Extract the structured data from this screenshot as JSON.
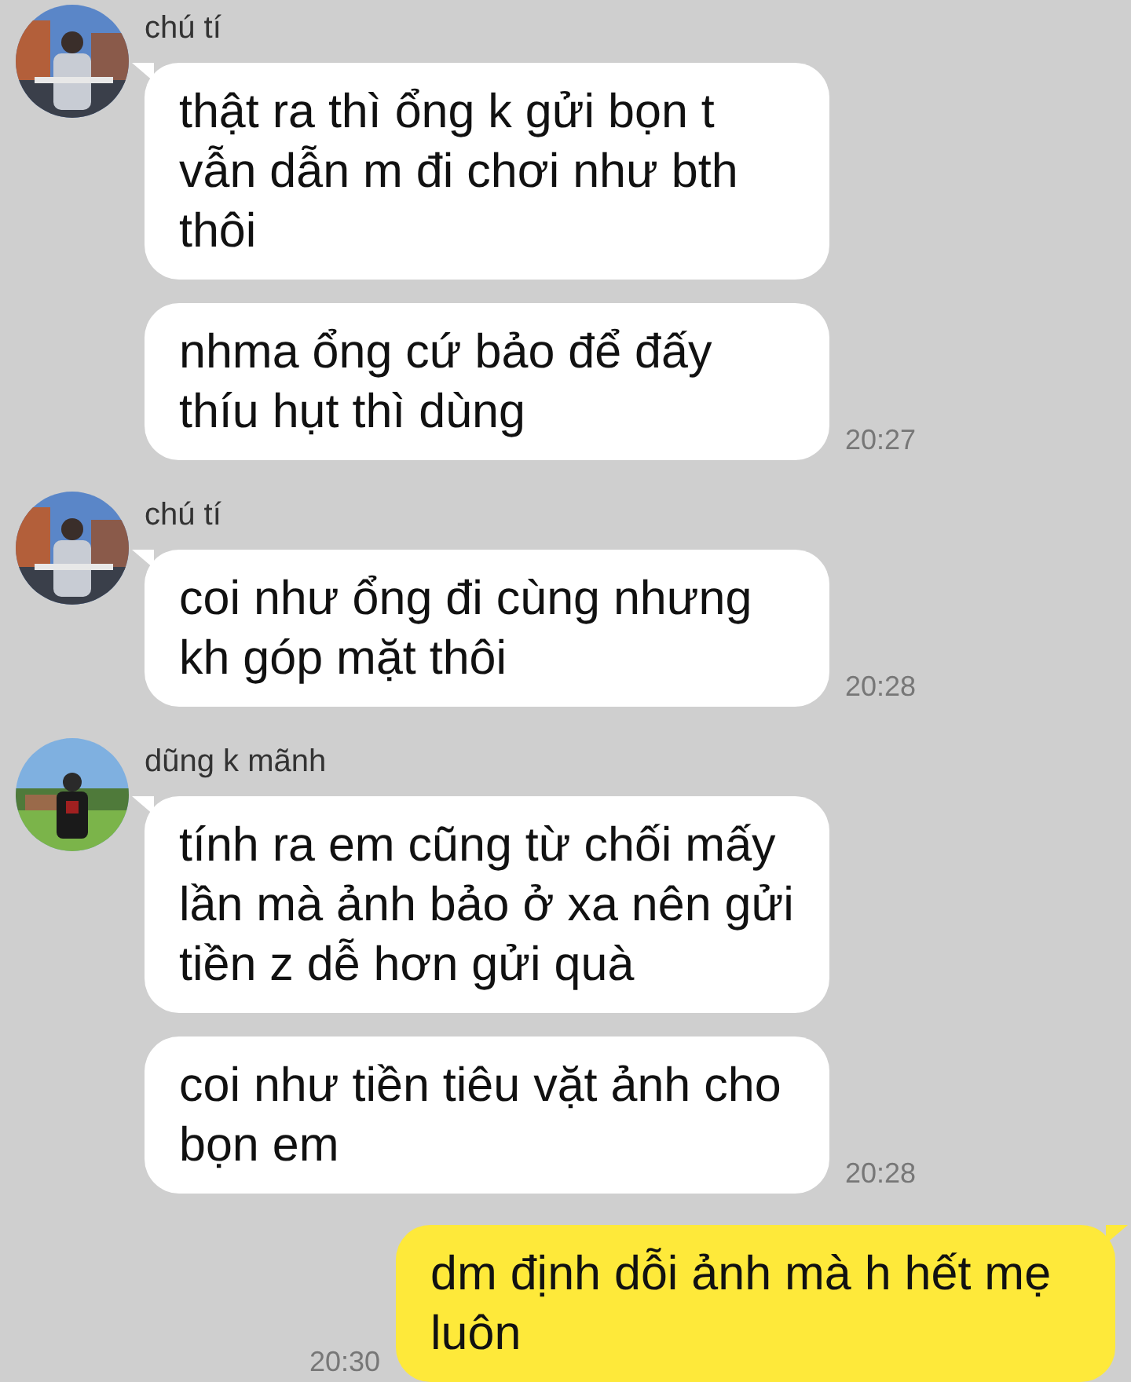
{
  "messages": [
    {
      "kind": "incoming",
      "sender": "chú tí",
      "bubbles": [
        "thật ra thì ổng k gửi bọn t vẫn dẫn m đi chơi như bth thôi",
        "nhma ổng cứ bảo để đấy thíu hụt thì dùng"
      ],
      "time": "20:27"
    },
    {
      "kind": "incoming",
      "sender": "chú tí",
      "bubbles": [
        "coi như ổng đi cùng nhưng kh góp mặt thôi"
      ],
      "time": "20:28"
    },
    {
      "kind": "incoming",
      "sender": "dũng k mãnh",
      "bubbles": [
        "tính ra em cũng từ chối mấy lần mà ảnh bảo ở xa nên gửi tiền z dễ hơn gửi quà",
        "coi như tiền tiêu vặt ảnh cho bọn em"
      ],
      "time": "20:28"
    },
    {
      "kind": "outgoing",
      "bubbles": [
        "dm định dỗi ảnh mà h hết mẹ luôn"
      ],
      "time": "20:30"
    }
  ]
}
